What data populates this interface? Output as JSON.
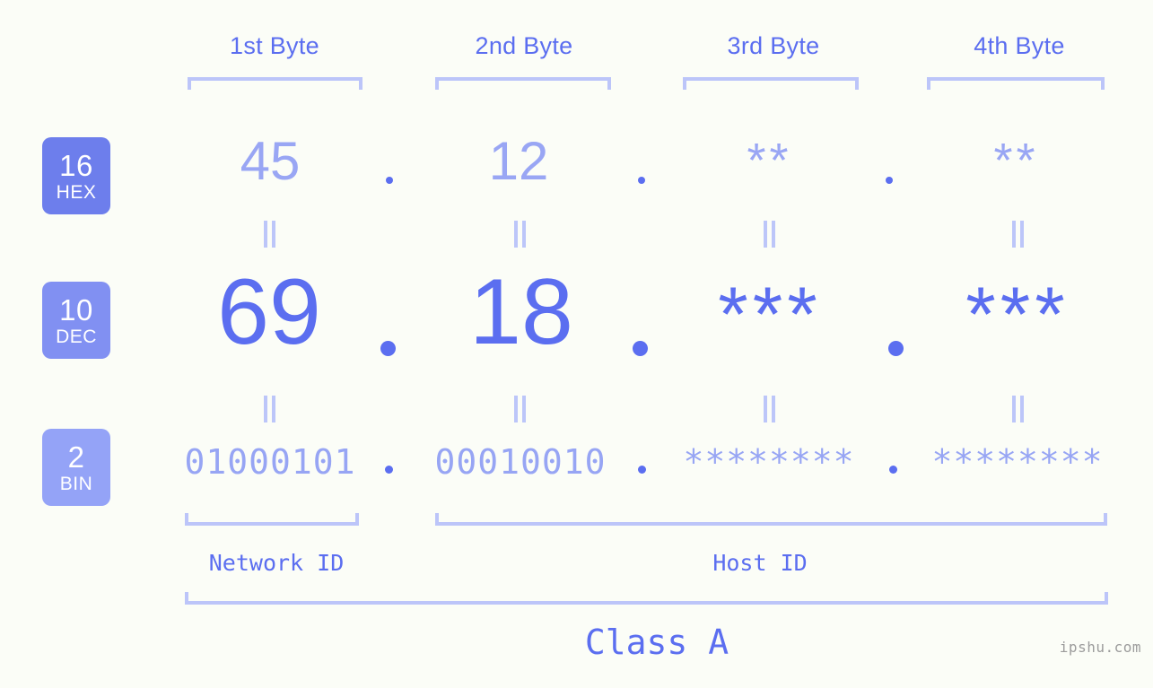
{
  "meta": {
    "background_color": "#fbfdf7",
    "accent_color": "#5b6ef0",
    "accent_light": "#99a6f4",
    "accent_lighter": "#bcc5f9",
    "watermark": "ipshu.com"
  },
  "byte_headers": [
    {
      "label": "1st Byte"
    },
    {
      "label": "2nd Byte"
    },
    {
      "label": "3rd Byte"
    },
    {
      "label": "4th Byte"
    }
  ],
  "bases": [
    {
      "number": "16",
      "name": "HEX",
      "color": "#6d7eec"
    },
    {
      "number": "10",
      "name": "DEC",
      "color": "#8190f2"
    },
    {
      "number": "2",
      "name": "BIN",
      "color": "#94a3f7"
    }
  ],
  "rows": {
    "hex": {
      "values": [
        "45",
        "12",
        "**",
        "**"
      ]
    },
    "dec": {
      "values": [
        "69",
        "18",
        "***",
        "***"
      ]
    },
    "bin": {
      "values": [
        "01000101",
        "00010010",
        "********",
        "********"
      ]
    }
  },
  "separator": {
    "glyph": "."
  },
  "equals": {
    "glyph": "||"
  },
  "id_sections": [
    {
      "label": "Network ID"
    },
    {
      "label": "Host ID"
    }
  ],
  "class_section": {
    "label": "Class A"
  }
}
